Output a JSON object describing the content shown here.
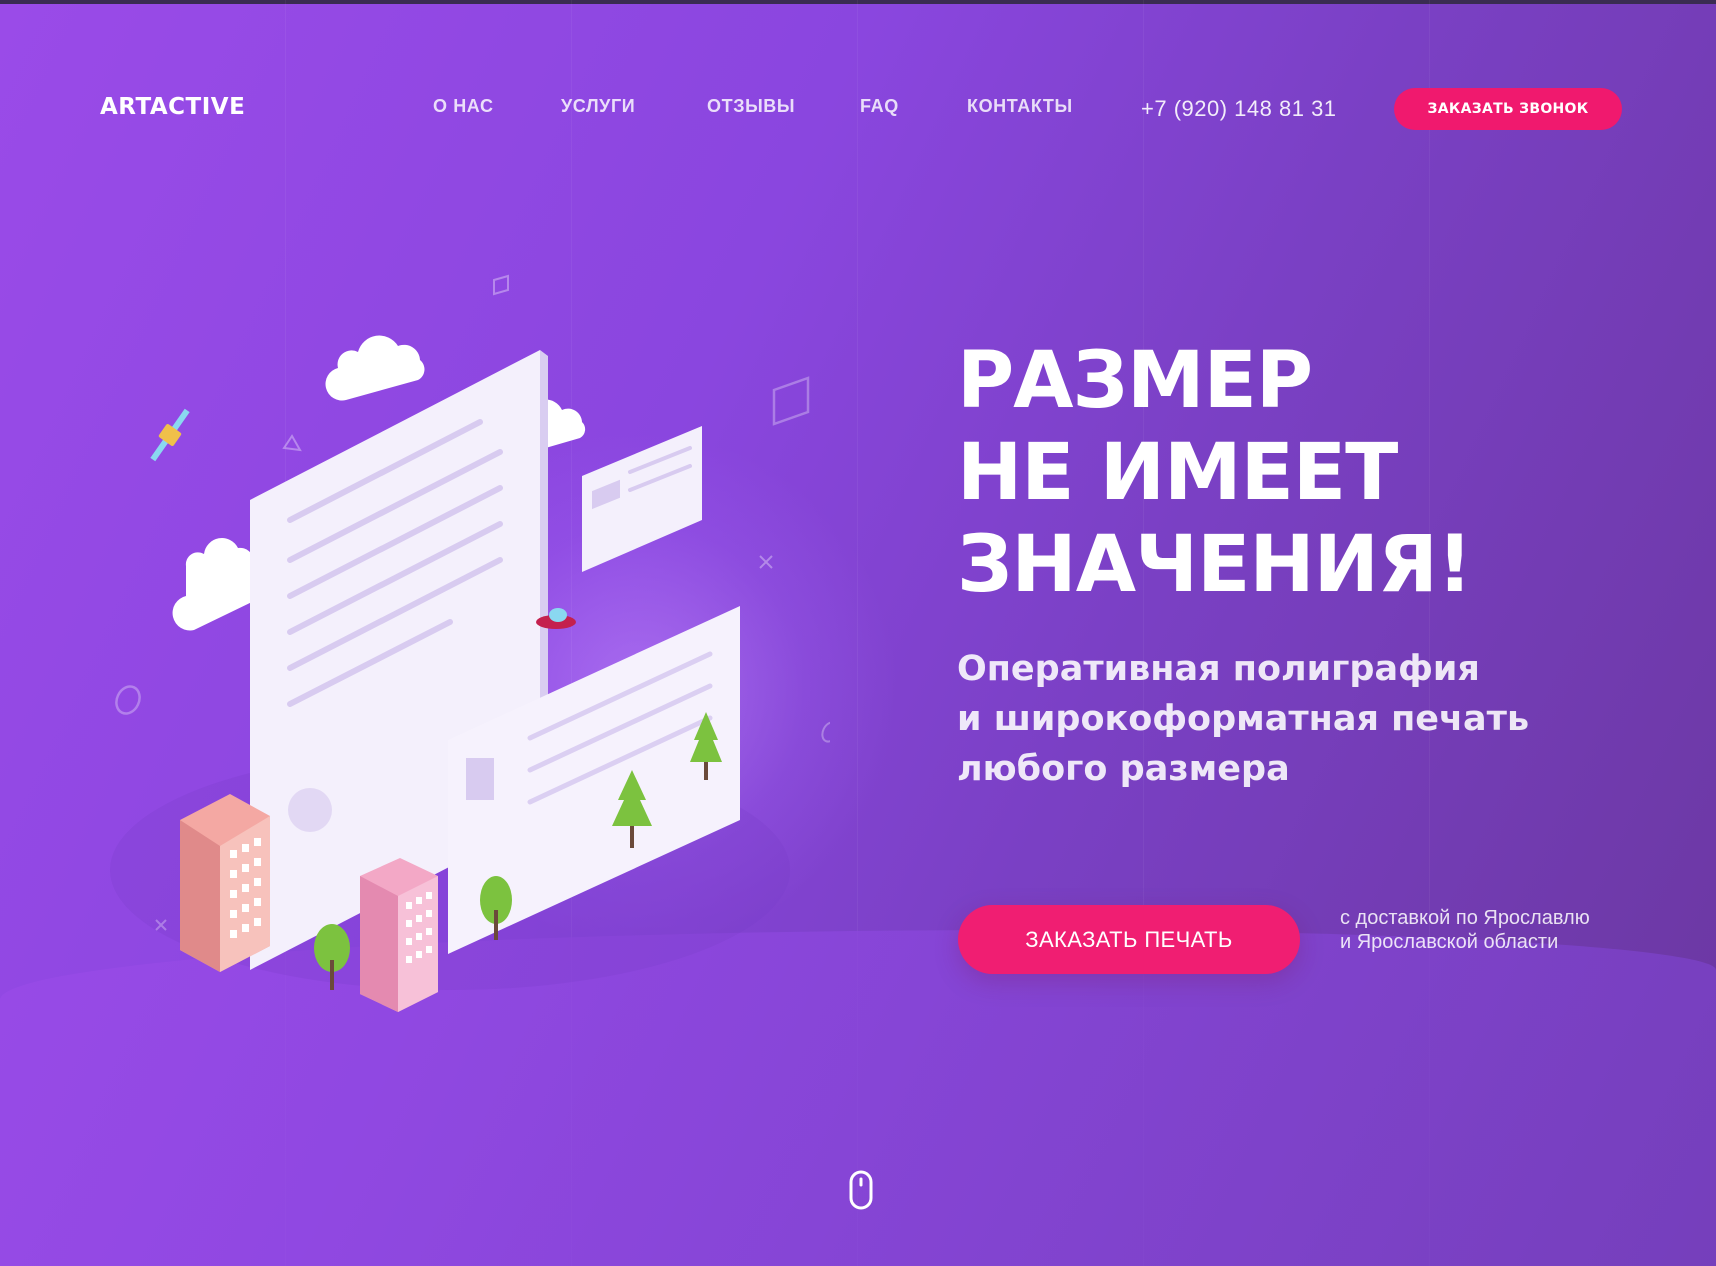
{
  "header": {
    "logo": "ARTACTIVE",
    "nav": [
      "О НАС",
      "УСЛУГИ",
      "ОТЗЫВЫ",
      "FAQ",
      "КОНТАКТЫ"
    ],
    "phone": "+7 (920) 148 81 31",
    "callback_label": "ЗАКАЗАТЬ ЗВОНОК"
  },
  "hero": {
    "title_lines": [
      "РАЗМЕР",
      "НЕ ИМЕЕТ",
      "ЗНАЧЕНИЯ!"
    ],
    "subtitle_lines": [
      "Оперативная полиграфия",
      "и широкоформатная печать",
      "любого размера"
    ],
    "cta_label": "ЗАКАЗАТЬ ПЕЧАТЬ",
    "delivery_lines": [
      "с доставкой по Ярославлю",
      "и Ярославской области"
    ]
  },
  "icons": {
    "scroll": "mouse-scroll-icon",
    "illustration": "isometric-print-illustration"
  },
  "colors": {
    "accent": "#f01e72",
    "background_start": "#9a4be8",
    "background_end": "#6a379f"
  }
}
